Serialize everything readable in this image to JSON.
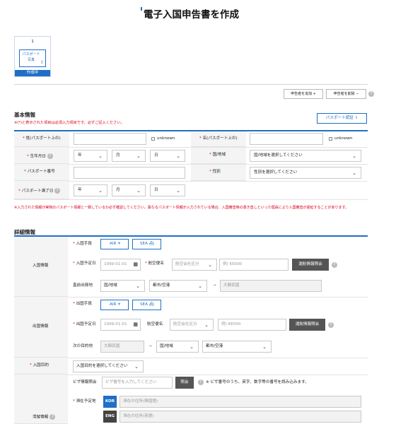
{
  "page_title": "電子入国申告書を作成",
  "step": {
    "number": "1",
    "photo_label": "パスポート\n写真",
    "status": "作成中"
  },
  "buttons": {
    "add_applicant": "申告者を追加 +",
    "delete_applicant": "申告者を削除 −",
    "passport_scan": "パスポート認証"
  },
  "basic": {
    "title": "基本情報",
    "note": "※(*)と表示された項目は必須入力項目です。必ずご記入ください。",
    "surname_label": "姓(パスポート上の)",
    "unknown_label": "unknown",
    "given_label": "名(パスポート上の)",
    "dob_label": "生年月日",
    "nationality_label": "国/地域",
    "nationality_placeholder": "国/地域を選択してください",
    "passport_no_label": "パスポート番号",
    "gender_label": "性別",
    "gender_placeholder": "性別を選択してください",
    "expiry_label": "パスポート満了日",
    "year": "年",
    "month": "月",
    "day": "日",
    "warning": "※入力された情報が実物のパスポート情報と一致しているか必ず確認してください。異なるパスポート情報が入力されている場合、入国審査時の書き直しといった理由により入国審査が遅延することがあります。"
  },
  "detail": {
    "title": "詳細情報",
    "entry_section": "入国情報",
    "entry_method_label": "入国手段",
    "air": "AIR",
    "sea": "SEA",
    "entry_date_label": "入国予定日",
    "date_placeholder": "1999-01-01",
    "flight_label": "航空便名",
    "airline_placeholder": "航空会社区分",
    "flight_placeholder": "例) KE000",
    "flight_lookup": "運航情報照会",
    "origin_label": "直前出発地",
    "region_select": "国/地域",
    "city_select": "都市/空港",
    "korea_value": "大韓民国",
    "departure_section": "出国情報",
    "exit_method_label": "出国手段",
    "exit_date_label": "出国予定日",
    "dest_label": "次の目的地",
    "city_select2": "都市/空港",
    "purpose_label": "入国目的",
    "purpose_placeholder": "入国目的を選択してください",
    "stay_section": "滞留情報",
    "visa_label": "ビザ情報照会",
    "visa_placeholder": "ビザ番号を入力してください",
    "visa_button": "照会",
    "visa_note": "※ ビザ番号のうち、英字、数字等の番号を読み込みます。",
    "address_label": "滞在予定地",
    "kor_badge": "KOR",
    "eng_badge": "ENG",
    "address_kor_placeholder": "滞在の住所(韓国語)",
    "address_eng_placeholder": "滞在の住所(英語)"
  },
  "colors": {
    "accent": "#1f6fc5",
    "required": "#d8001a",
    "dark_button": "#555555"
  }
}
